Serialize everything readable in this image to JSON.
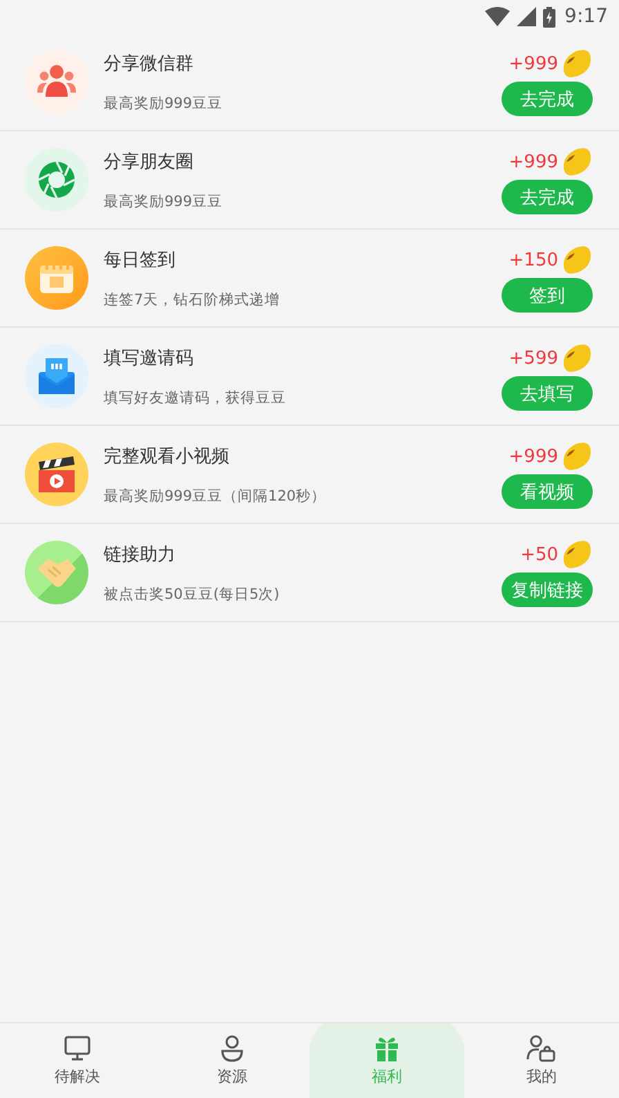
{
  "status_bar": {
    "time": "9:17"
  },
  "tasks": [
    {
      "kind": "group",
      "title": "分享微信群",
      "description": "最高奖励999豆豆",
      "reward": "+999",
      "button": "去完成"
    },
    {
      "kind": "moments",
      "title": "分享朋友圈",
      "description": "最高奖励999豆豆",
      "reward": "+999",
      "button": "去完成"
    },
    {
      "kind": "calendar",
      "title": "每日签到",
      "description": "连签7天，钻石阶梯式递增",
      "reward": "+150",
      "button": "签到"
    },
    {
      "kind": "invite",
      "title": "填写邀请码",
      "description": "填写好友邀请码，获得豆豆",
      "reward": "+599",
      "button": "去填写"
    },
    {
      "kind": "video",
      "title": "完整观看小视频",
      "description": "最高奖励999豆豆（间隔120秒）",
      "reward": "+999",
      "button": "看视频"
    },
    {
      "kind": "handshake",
      "title": "链接助力",
      "description": "被点击奖50豆豆(每日5次)",
      "reward": "+50",
      "button": "复制链接"
    }
  ],
  "tabs": [
    {
      "kind": "monitor",
      "label": "待解决",
      "selected": false
    },
    {
      "kind": "person",
      "label": "资源",
      "selected": false
    },
    {
      "kind": "gift",
      "label": "福利",
      "selected": true
    },
    {
      "kind": "profile",
      "label": "我的",
      "selected": false
    }
  ]
}
